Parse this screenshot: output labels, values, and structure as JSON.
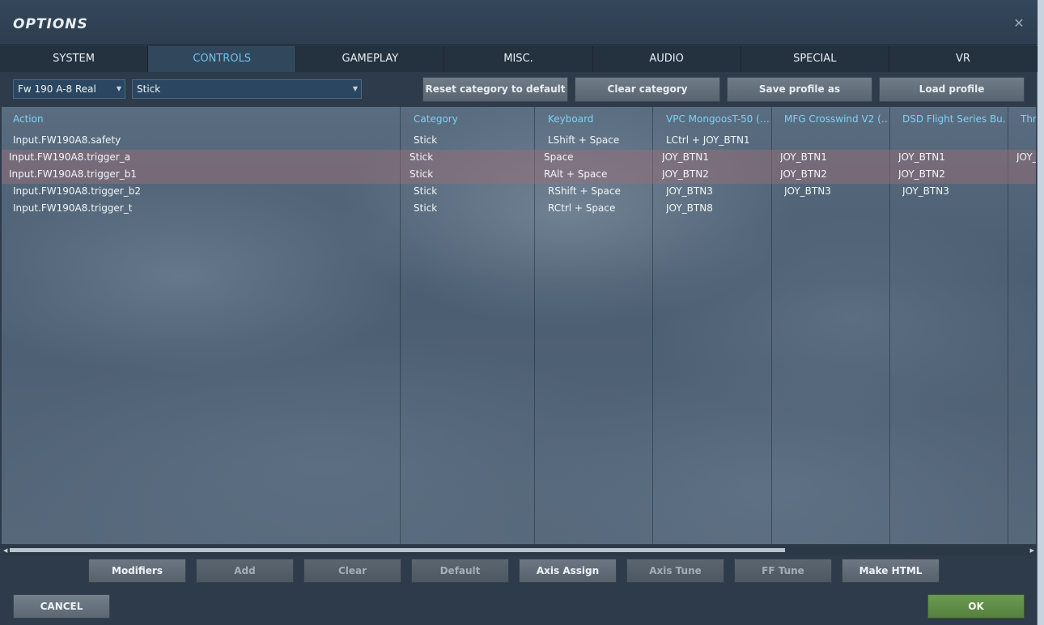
{
  "window": {
    "title": "OPTIONS",
    "close_glyph": "✕"
  },
  "tabs": [
    {
      "label": "SYSTEM",
      "active": false
    },
    {
      "label": "CONTROLS",
      "active": true
    },
    {
      "label": "GAMEPLAY",
      "active": false
    },
    {
      "label": "MISC.",
      "active": false
    },
    {
      "label": "AUDIO",
      "active": false
    },
    {
      "label": "SPECIAL",
      "active": false
    },
    {
      "label": "VR",
      "active": false
    }
  ],
  "toolbar": {
    "aircraft_select": "Fw 190 A-8 Real",
    "category_select": "Stick",
    "reset_label": "Reset category to default",
    "clear_category_label": "Clear category",
    "save_profile_label": "Save profile as",
    "load_profile_label": "Load profile"
  },
  "grid": {
    "headers": [
      "Action",
      "Category",
      "Keyboard",
      "VPC MongoosT-50 (…",
      "MFG Crosswind V2 (…",
      "DSD Flight Series Bu…",
      "Thr"
    ],
    "rows": [
      {
        "selected": false,
        "cells": [
          "Input.FW190A8.safety",
          "Stick",
          "LShift + Space",
          "LCtrl + JOY_BTN1",
          "",
          "",
          ""
        ]
      },
      {
        "selected": true,
        "cells": [
          "Input.FW190A8.trigger_a",
          "Stick",
          "Space",
          "JOY_BTN1",
          "JOY_BTN1",
          "JOY_BTN1",
          "JOY_"
        ]
      },
      {
        "selected": true,
        "cells": [
          "Input.FW190A8.trigger_b1",
          "Stick",
          "RAlt + Space",
          "JOY_BTN2",
          "JOY_BTN2",
          "JOY_BTN2",
          ""
        ]
      },
      {
        "selected": false,
        "cells": [
          "Input.FW190A8.trigger_b2",
          "Stick",
          "RShift + Space",
          "JOY_BTN3",
          "JOY_BTN3",
          "JOY_BTN3",
          ""
        ]
      },
      {
        "selected": false,
        "cells": [
          "Input.FW190A8.trigger_t",
          "Stick",
          "RCtrl + Space",
          "JOY_BTN8",
          "",
          "",
          ""
        ]
      }
    ]
  },
  "bottom_buttons": [
    {
      "label": "Modifiers",
      "enabled": true
    },
    {
      "label": "Add",
      "enabled": false
    },
    {
      "label": "Clear",
      "enabled": false
    },
    {
      "label": "Default",
      "enabled": false
    },
    {
      "label": "Axis Assign",
      "enabled": true
    },
    {
      "label": "Axis Tune",
      "enabled": false
    },
    {
      "label": "FF Tune",
      "enabled": false
    },
    {
      "label": "Make HTML",
      "enabled": true
    }
  ],
  "footer": {
    "cancel_label": "CANCEL",
    "ok_label": "OK"
  }
}
